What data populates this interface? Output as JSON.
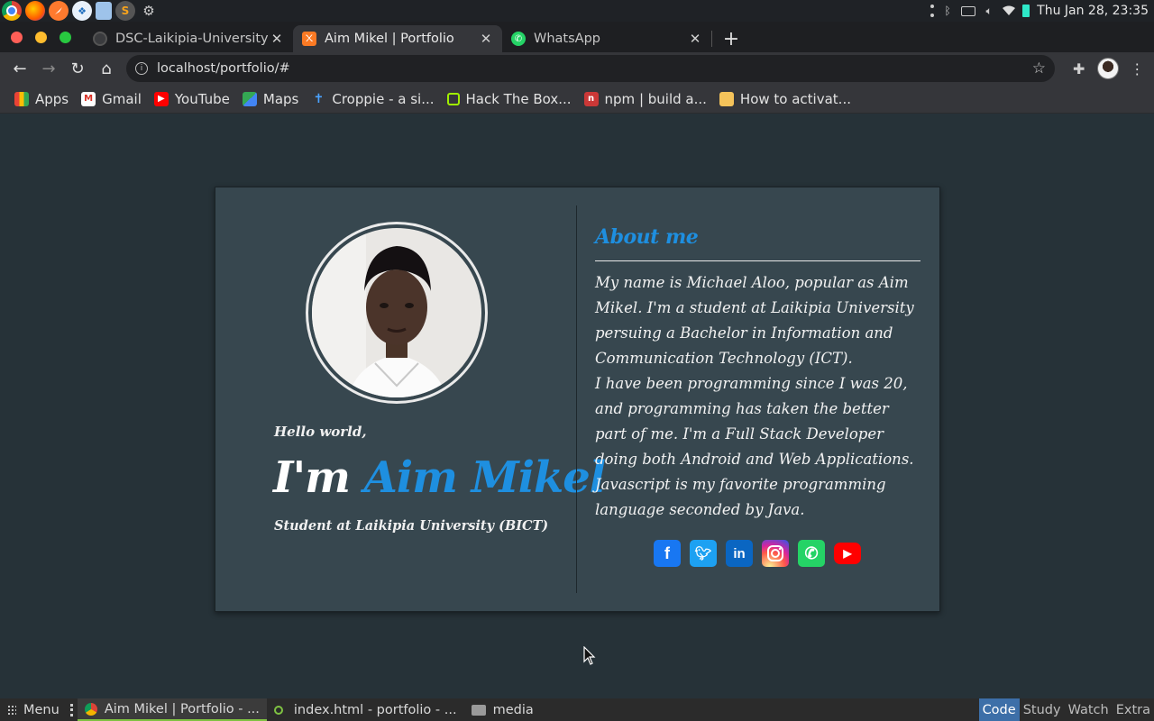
{
  "system": {
    "clock": "Thu Jan 28, 23:35"
  },
  "browser": {
    "tabs": [
      {
        "title": "DSC-Laikipia-University",
        "active": false,
        "icon": "github-icon"
      },
      {
        "title": "Aim Mikel | Portfolio",
        "active": true,
        "icon": "xampp-icon"
      },
      {
        "title": "WhatsApp",
        "active": false,
        "icon": "whatsapp-icon"
      }
    ],
    "url": "localhost/portfolio/#",
    "bookmarks": [
      {
        "label": "Apps",
        "icon": "apps-grid-icon"
      },
      {
        "label": "Gmail",
        "icon": "gmail-icon"
      },
      {
        "label": "YouTube",
        "icon": "youtube-icon"
      },
      {
        "label": "Maps",
        "icon": "maps-icon"
      },
      {
        "label": "Croppie - a si...",
        "icon": "croppie-icon"
      },
      {
        "label": "Hack The Box...",
        "icon": "hackthebox-icon"
      },
      {
        "label": "npm | build a...",
        "icon": "npm-icon"
      },
      {
        "label": "How to activat...",
        "icon": "folder-icon"
      }
    ]
  },
  "page": {
    "hello": "Hello world,",
    "im": "I'm",
    "name": "Aim Mikel",
    "subtitle": "Student at Laikipia University (BICT)",
    "about_title": "About me",
    "about_p1": "My name is Michael Aloo, popular as Aim Mikel. I'm a student at Laikipia University persuing a Bachelor in Information and Communication Technology (ICT).",
    "about_p2": "I have been programming since I was 20, and programming has taken the better part of me. I'm a Full Stack Developer doing both Android and Web Applications. Javascript is my favorite programming language seconded by Java.",
    "accent_color": "#1e8fe0",
    "socials": [
      "facebook-icon",
      "twitter-icon",
      "linkedin-icon",
      "instagram-icon",
      "whatsapp-icon",
      "youtube-icon"
    ]
  },
  "taskbar": {
    "menu": "Menu",
    "items": [
      {
        "label": "Aim Mikel | Portfolio - ...",
        "active": true
      },
      {
        "label": "index.html - portfolio - ...",
        "active": false
      },
      {
        "label": "media",
        "active": false
      }
    ],
    "workspaces": [
      "Code",
      "Study",
      "Watch",
      "Extra"
    ]
  }
}
